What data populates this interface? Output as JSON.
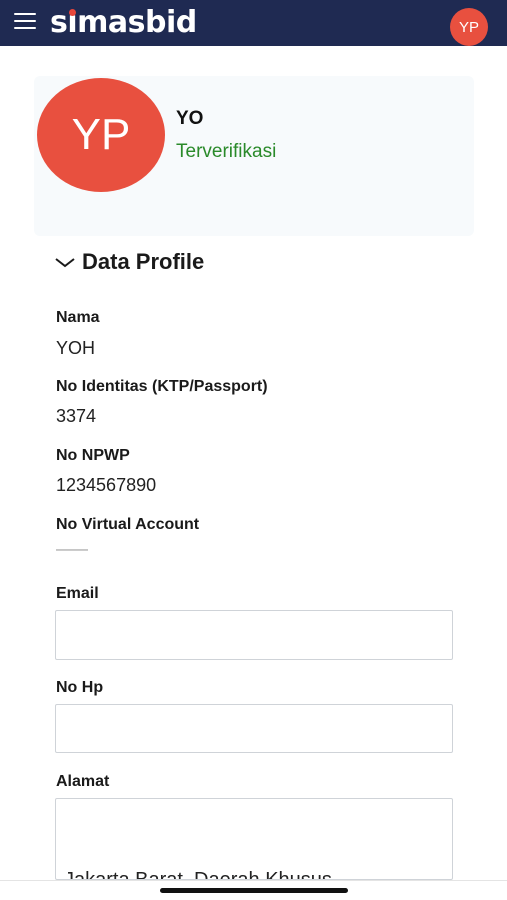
{
  "header": {
    "logo_part1": "s",
    "logo_i": "ı",
    "logo_part2": "masbid",
    "avatar_initials": "YP",
    "colors": {
      "bar": "#1f2a52",
      "logo_dot": "#e8463a",
      "avatar": "#e8503f"
    },
    "menu_icon": "hamburger-menu-icon"
  },
  "profile": {
    "avatar_initials": "YP",
    "name": "YO",
    "status": "Terverifikasi",
    "status_color": "#2a8a2a"
  },
  "section": {
    "title": "Data Profile",
    "toggle_icon": "chevron-down-icon"
  },
  "fields": {
    "nama": {
      "label": "Nama",
      "value": "YOH"
    },
    "no_identitas": {
      "label": "No Identitas (KTP/Passport)",
      "value": "3374"
    },
    "no_npwp": {
      "label": "No NPWP",
      "value": "1234567890"
    },
    "no_virtual_account": {
      "label": "No Virtual Account",
      "value": "——"
    },
    "email": {
      "label": "Email",
      "value": ""
    },
    "no_hp": {
      "label": "No Hp",
      "value": ""
    },
    "alamat": {
      "label": "Alamat",
      "value": "Jakarta Barat, Daerah Khusus"
    }
  }
}
